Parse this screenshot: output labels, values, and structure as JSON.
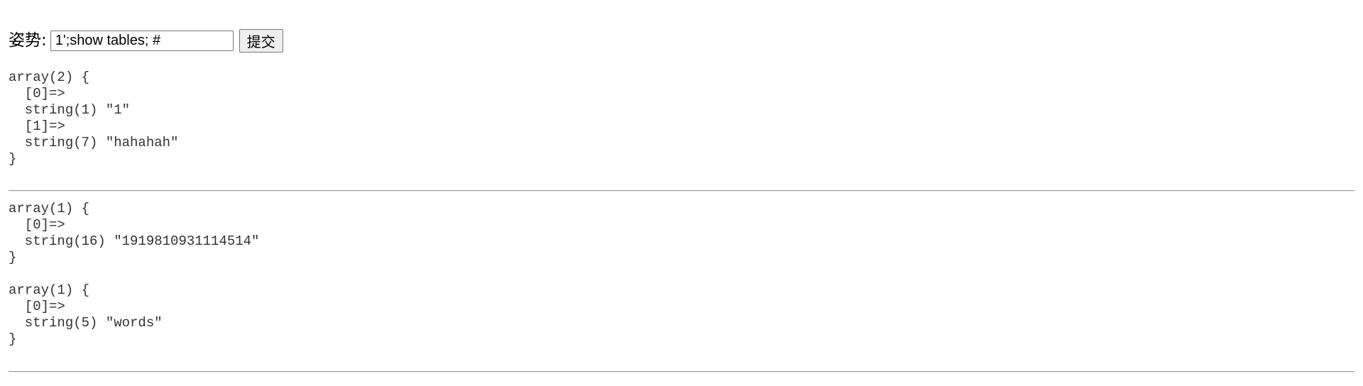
{
  "form": {
    "label": "姿势:",
    "input_value": "1';show tables; #",
    "submit_label": "提交"
  },
  "results": [
    {
      "lines": [
        "array(2) {",
        "  [0]=>",
        "  string(1) \"1\"",
        "  [1]=>",
        "  string(7) \"hahahah\"",
        "}"
      ]
    },
    {
      "lines": [
        "array(1) {",
        "  [0]=>",
        "  string(16) \"1919810931114514\"",
        "}"
      ]
    },
    {
      "lines": [
        "array(1) {",
        "  [0]=>",
        "  string(5) \"words\"",
        "}"
      ]
    }
  ]
}
